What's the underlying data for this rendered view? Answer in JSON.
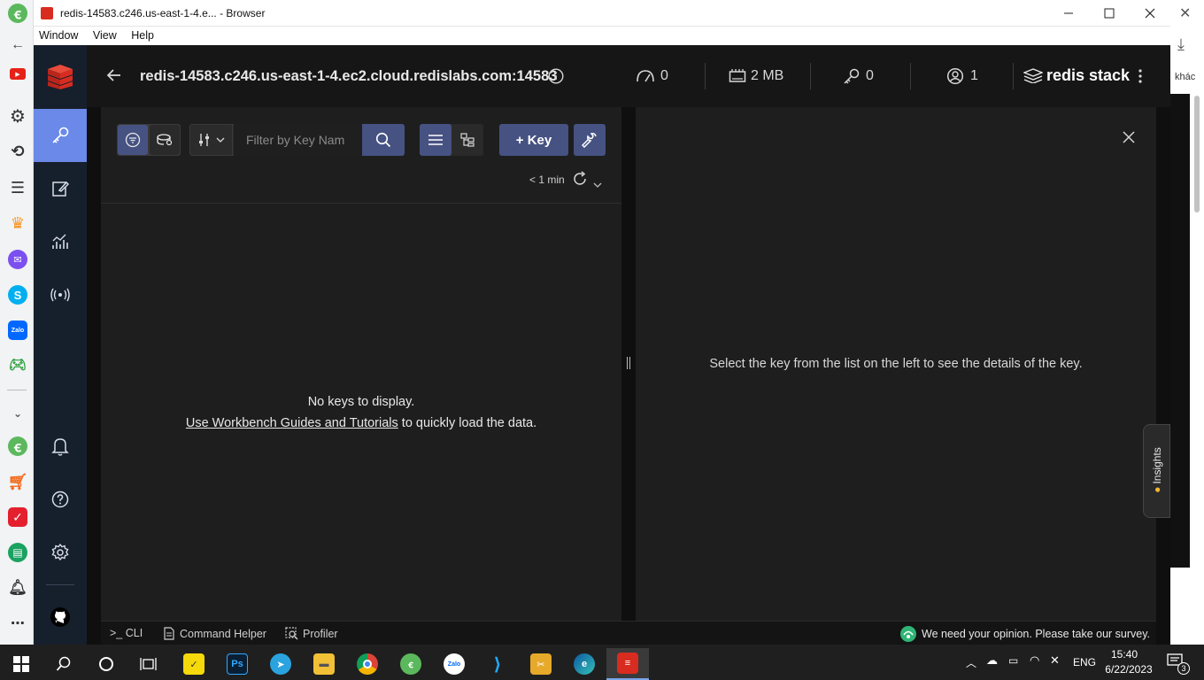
{
  "window": {
    "title": "redis-14583.c246.us-east-1-4.e... - Browser",
    "menu": [
      "Window",
      "View",
      "Help"
    ]
  },
  "outer_browser": {
    "right_strip_label": "khác"
  },
  "redis": {
    "db_name": "redis-14583.c246.us-east-1-4.ec2.cloud.redislabs.com:14583",
    "stats": {
      "cpu": "0",
      "memory": "2 MB",
      "keys": "0",
      "clients": "1"
    },
    "brand": "redis stack",
    "toolbar": {
      "filter_placeholder": "Filter by Key Nam",
      "add_key_label": "+ Key",
      "refresh_label": "< 1 min"
    },
    "empty_state": {
      "message": "No keys to display.",
      "link_text": "Use Workbench Guides and Tutorials",
      "suffix": " to quickly load the data."
    },
    "details_hint": "Select the key from the list on the left to see the details of the key.",
    "insights_label": "Insights",
    "bottom": {
      "cli": ">_ CLI",
      "command_helper": "Command Helper",
      "profiler": "Profiler",
      "survey": "We need your opinion. Please take our survey."
    }
  },
  "taskbar": {
    "language": "ENG",
    "time": "15:40",
    "date": "6/22/2023",
    "notification_count": "3"
  },
  "colors": {
    "sidebar_bg": "#161f2c",
    "active_accent": "#6a89e8",
    "button_accent": "#465282",
    "panel_bg": "#1e1e1e",
    "redis_red": "#d82c20"
  }
}
